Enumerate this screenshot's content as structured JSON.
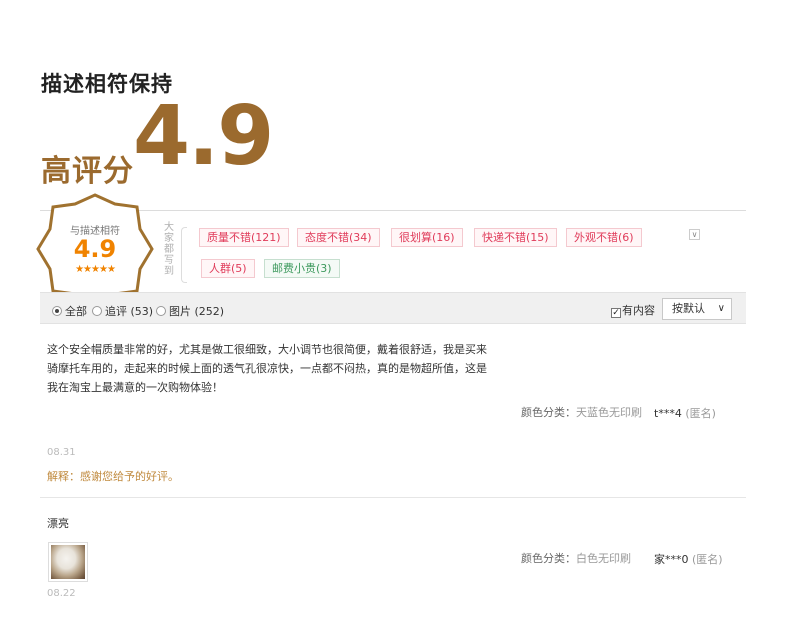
{
  "headline": "描述相符保持",
  "high_score_label": "高评分",
  "big_score": "4.9",
  "badge": {
    "label": "与描述相符",
    "score": "4.9",
    "stars": "★★★★★"
  },
  "side_label": "大家都写到",
  "tags": [
    {
      "label": "质量不错(121)",
      "tone": "negative"
    },
    {
      "label": "态度不错(34)",
      "tone": "negative"
    },
    {
      "label": "很划算(16)",
      "tone": "negative"
    },
    {
      "label": "快递不错(15)",
      "tone": "negative"
    },
    {
      "label": "外观不错(6)",
      "tone": "negative"
    },
    {
      "label": "人群(5)",
      "tone": "negative"
    },
    {
      "label": "邮费小贵(3)",
      "tone": "positive"
    }
  ],
  "filters": {
    "all": "全部",
    "followup": "追评 (53)",
    "photos": "图片 (252)",
    "has_content": "有内容",
    "sort": "按默认"
  },
  "reviews": [
    {
      "text": "这个安全帽质量非常的好，尤其是做工很细致，大小调节也很简便，戴着很舒适，我是买来骑摩托车用的，走起来的时候上面的透气孔很凉快，一点都不闷热，真的是物超所值，这是我在淘宝上最满意的一次购物体验！",
      "sku_label": "颜色分类：",
      "sku_value": "天蓝色无印刷",
      "user": "t***4",
      "anon": "(匿名)",
      "date": "08.31",
      "reply": "解释：感谢您给予的好评。"
    },
    {
      "text": "漂亮",
      "sku_label": "颜色分类：",
      "sku_value": "白色无印刷",
      "user": "家***0",
      "anon": "(匿名)",
      "date": "08.22"
    }
  ],
  "colors": {
    "brand_brown": "#9b6a2e",
    "badge_orange": "#f08300",
    "tag_red": "#e03b5a",
    "tag_green": "#3e9a5e"
  }
}
